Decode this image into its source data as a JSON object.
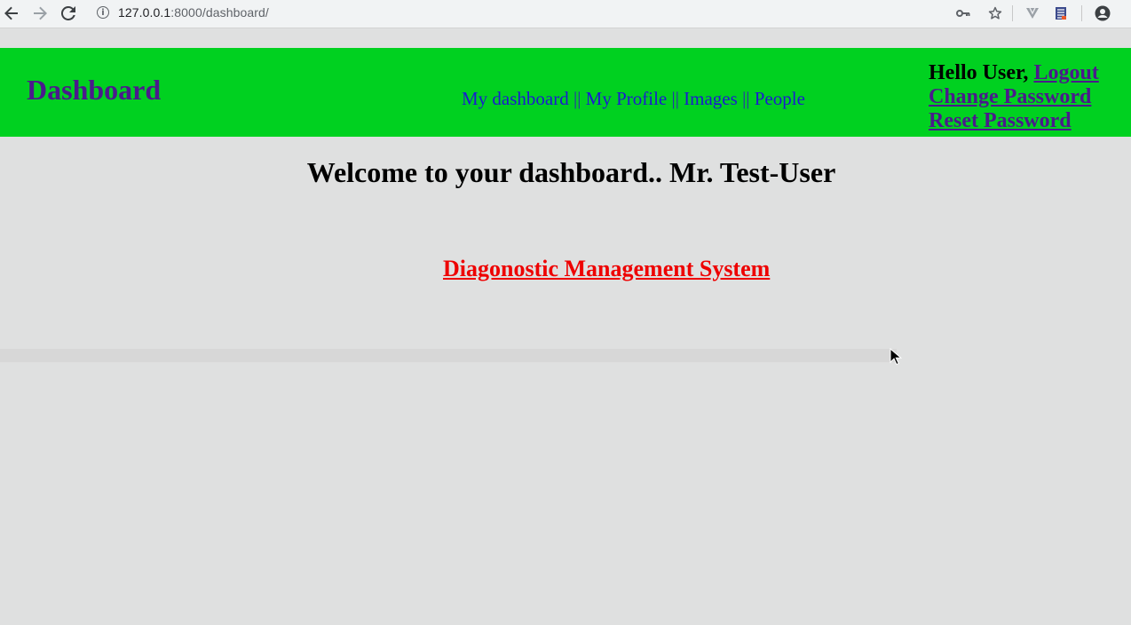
{
  "browser": {
    "url_host": "127.0.0.1",
    "url_rest": ":8000/dashboard/",
    "icons": [
      "back-arrow-icon",
      "forward-arrow-icon",
      "reload-icon",
      "info-icon",
      "key-icon",
      "star-icon",
      "extension-v-icon",
      "extension-list-icon",
      "account-icon"
    ]
  },
  "header": {
    "brand": "Dashboard",
    "nav": {
      "my_dashboard": "My dashboard",
      "my_profile": "My Profile",
      "images": "Images",
      "people": "People",
      "divider": "||"
    },
    "user": {
      "greeting": "Hello User,",
      "logout": "Logout",
      "change_password": "Change Password",
      "reset_password": "Reset Password"
    }
  },
  "main": {
    "welcome": "Welcome to your dashboard.. Mr. Test-User",
    "dms_link": "Diagonostic Management System"
  },
  "colors": {
    "header_bg": "#00d120",
    "brand": "#4b1a8c",
    "nav_link": "#1b1bd0",
    "dms_link": "#ee0000",
    "page_bg": "#dfe0e0"
  }
}
